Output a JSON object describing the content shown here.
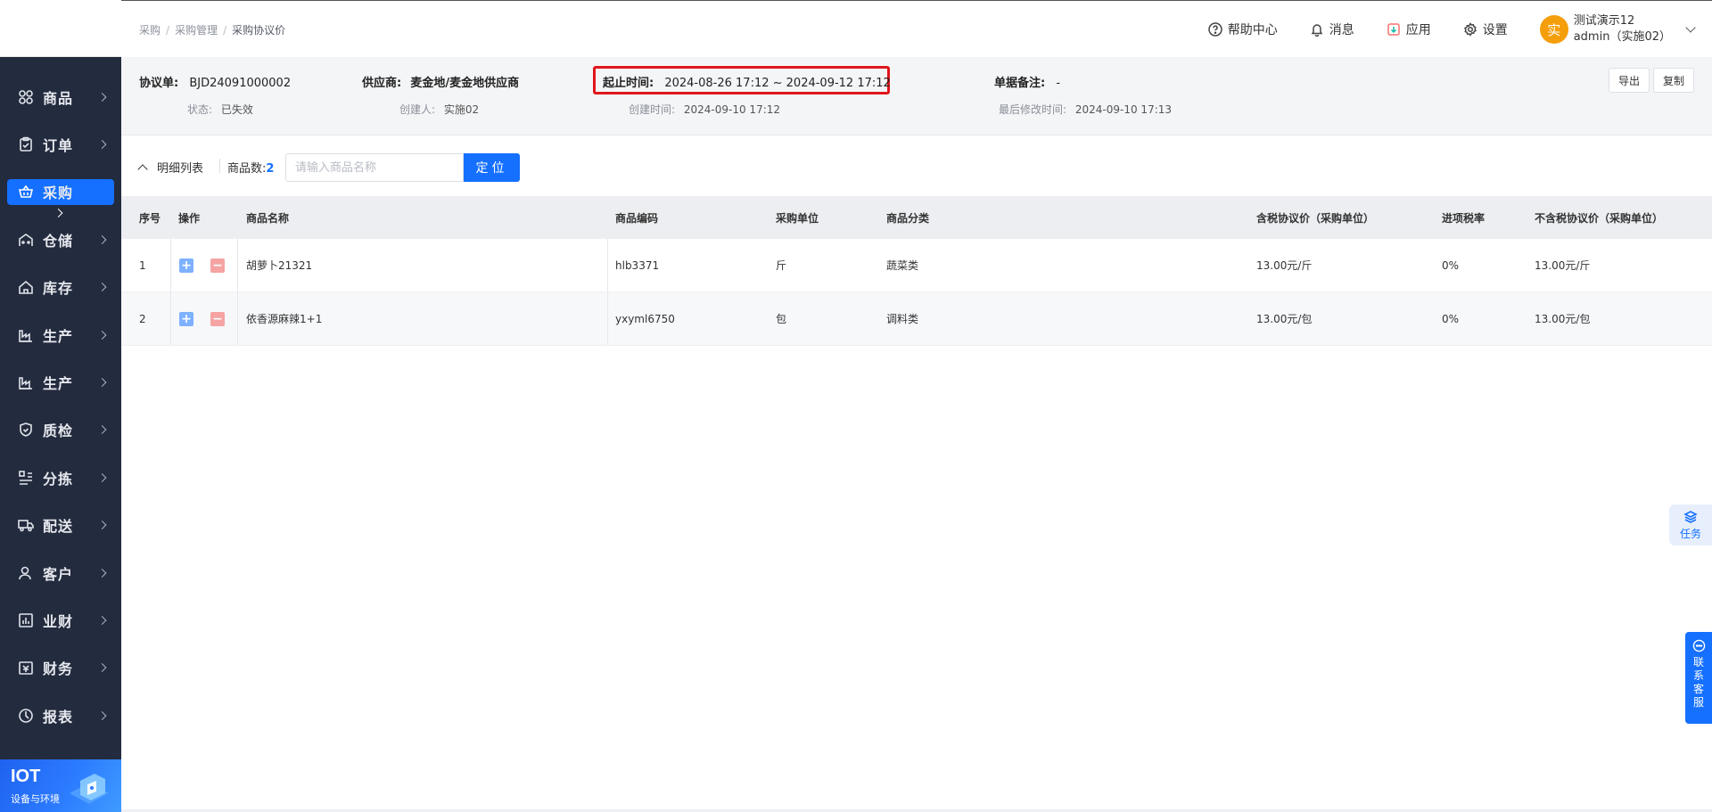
{
  "sidebar": {
    "items": [
      {
        "label": "商品",
        "icon": "grid-icon"
      },
      {
        "label": "订单",
        "icon": "clipboard-icon"
      },
      {
        "label": "采购",
        "icon": "basket-icon"
      },
      {
        "label": "仓储",
        "icon": "warehouse-icon"
      },
      {
        "label": "库存",
        "icon": "home-icon"
      },
      {
        "label": "生产",
        "icon": "factory-icon"
      },
      {
        "label": "生产",
        "icon": "factory-icon"
      },
      {
        "label": "质检",
        "icon": "shield-icon"
      },
      {
        "label": "分拣",
        "icon": "sort-icon"
      },
      {
        "label": "配送",
        "icon": "truck-icon"
      },
      {
        "label": "客户",
        "icon": "user-icon"
      },
      {
        "label": "业财",
        "icon": "bar-chart-icon"
      },
      {
        "label": "财务",
        "icon": "ledger-icon"
      },
      {
        "label": "报表",
        "icon": "pie-chart-icon"
      }
    ],
    "active_index": 2,
    "iot": {
      "title": "IOT",
      "subtitle": "设备与环境"
    }
  },
  "header": {
    "breadcrumb": [
      "采购",
      "采购管理",
      "采购协议价"
    ],
    "tools": {
      "help": "帮助中心",
      "messages": "消息",
      "apps": "应用",
      "settings": "设置"
    },
    "user": {
      "avatar_char": "实",
      "name": "测试演示12",
      "account": "admin（实施02）",
      "avatar_color": "#f59e0b"
    }
  },
  "info": {
    "agreement_label": "协议单:",
    "agreement_value": "BJD24091000002",
    "supplier_label": "供应商:",
    "supplier_value": "麦金地/麦金地供应商",
    "period_label": "起止时间:",
    "period_value": "2024-08-26 17:12 ~ 2024-09-12 17:12",
    "remark_label": "单据备注:",
    "remark_value": "-",
    "status_label": "状态:",
    "status_value": "已失效",
    "creator_label": "创建人:",
    "creator_value": "实施02",
    "created_label": "创建时间:",
    "created_value": "2024-09-10 17:12",
    "modified_label": "最后修改时间:",
    "modified_value": "2024-09-10 17:13",
    "export_label": "导出",
    "copy_label": "复制"
  },
  "detail": {
    "list_label": "明细列表",
    "count_label": "商品数:",
    "count_value": "2",
    "search_placeholder": "请输入商品名称",
    "locate_label": "定位"
  },
  "table": {
    "headers": {
      "seq": "序号",
      "op": "操作",
      "name": "商品名称",
      "code": "商品编码",
      "unit": "采购单位",
      "category": "商品分类",
      "tax_price": "含税协议价（采购单位）",
      "tax_rate": "进项税率",
      "notax_price": "不含税协议价（采购单位）"
    },
    "rows": [
      {
        "seq": "1",
        "name": "胡萝卜21321",
        "code": "hlb3371",
        "unit": "斤",
        "category": "蔬菜类",
        "tax_price": "13.00元/斤",
        "tax_rate": "0%",
        "notax_price": "13.00元/斤"
      },
      {
        "seq": "2",
        "name": "依香源麻辣1+1",
        "code": "yxyml6750",
        "unit": "包",
        "category": "调料类",
        "tax_price": "13.00元/包",
        "tax_rate": "0%",
        "notax_price": "13.00元/包"
      }
    ]
  },
  "floats": {
    "task_label": "任务",
    "contact_label": [
      "联",
      "系",
      "客",
      "服"
    ]
  },
  "colors": {
    "primary": "#1570ff",
    "sidebar_bg": "#232b3e",
    "highlight": "#e0161b"
  }
}
